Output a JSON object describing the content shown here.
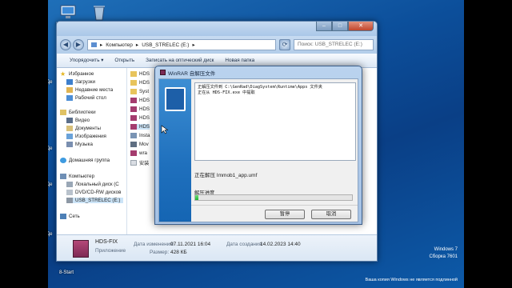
{
  "desktop": {
    "icons": [
      {
        "label": "Ко",
        "icon": "computer-icon"
      },
      {
        "label": "",
        "icon": "recycle-bin-icon"
      }
    ],
    "left_edge_labels": [
      "Де",
      "Де",
      "Де",
      "Де"
    ],
    "taskbar_left_label": "8-Start",
    "watermark": {
      "line1": "Windows 7",
      "line2": "Сборка 7601",
      "line3": "Ваша копия Windows не является подлинной"
    }
  },
  "explorer": {
    "breadcrumb": [
      "Компьютер",
      "USB_STRELEC (E:)"
    ],
    "search_placeholder": "Поиск: USB_STRELEC (E:)",
    "toolbar": [
      "Упорядочить ▾",
      "Открыть",
      "Записать на оптический диск",
      "Новая папка"
    ],
    "sidebar": {
      "favorites_header": "Избранное",
      "favorites": [
        "Загрузки",
        "Недавние места",
        "Рабочий стол"
      ],
      "libraries_header": "Библиотеки",
      "libraries": [
        "Видео",
        "Документы",
        "Изображения",
        "Музыка"
      ],
      "homegroup": "Домашняя группа",
      "computer_header": "Компьютер",
      "drives": [
        "Локальный диск (C",
        "DVD/CD-RW дисков",
        "USB_STRELEC (E:)"
      ],
      "network": "Сеть"
    },
    "files": [
      "HDS",
      "HDS",
      "Syst",
      "HDS",
      "HDS",
      "HDS",
      "HDS",
      "Insta",
      "Mov",
      "wra",
      "安装"
    ],
    "details": {
      "name": "HDS-FIX",
      "type": "Приложение",
      "modified_label": "Дата изменения:",
      "modified_value": "07.11.2021 16:04",
      "size_label": "Размер:",
      "size_value": "428 КБ",
      "created_label": "Дата создания:",
      "created_value": "14.02.2023 14:40"
    }
  },
  "winrar": {
    "title": "WinRAR 自解压文件",
    "log": [
      "正解压文件到 C:\\GenRad\\DiagSystem\\Runtime\\Apps 文件夹",
      "正在从 HDS-FIX.exe 中提取"
    ],
    "status": "正在解压 Immob1_app.umf",
    "progress_label": "解压进度",
    "progress": 0.02,
    "pause_button": "暂停",
    "cancel_button": "取消"
  },
  "colors": {
    "accent": "#1f70bd",
    "progress": "#1fb431"
  }
}
